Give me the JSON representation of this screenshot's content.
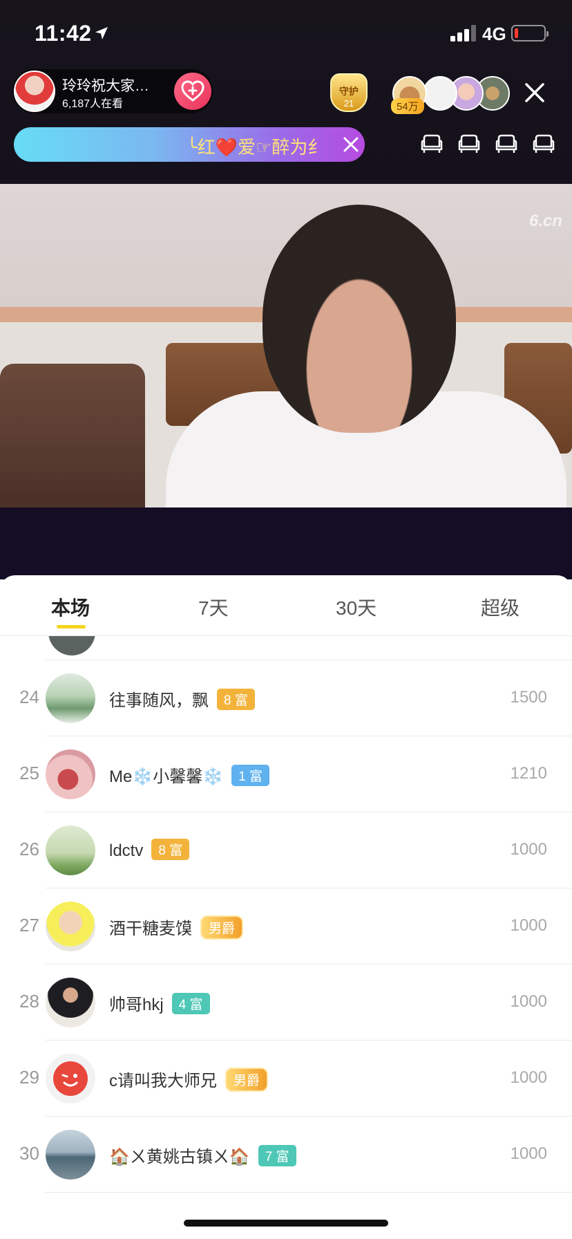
{
  "status_bar": {
    "time": "11:42",
    "network": "4G"
  },
  "live_header": {
    "host_name": "玲玲祝大家…",
    "viewers": "6,187人在看",
    "guard_label": "守护",
    "guard_count": "21",
    "fan_tag": "54万"
  },
  "marquee": {
    "text": "╰红❤️爱☞醉为纟"
  },
  "tabs": [
    {
      "label": "本场",
      "active": true
    },
    {
      "label": "7天",
      "active": false
    },
    {
      "label": "30天",
      "active": false
    },
    {
      "label": "超级",
      "active": false
    }
  ],
  "ranking": [
    {
      "rank": "24",
      "name": "往事随风，飘",
      "badge": "8 富",
      "badge_color": "#f3b33b",
      "score": "1500"
    },
    {
      "rank": "25",
      "name": "Me❄️小馨馨❄️",
      "badge": "1 富",
      "badge_color": "#5fb1ef",
      "score": "1210"
    },
    {
      "rank": "26",
      "name": "ldctv",
      "badge": "8 富",
      "badge_color": "#f3b33b",
      "score": "1000"
    },
    {
      "rank": "27",
      "name": "酒干糖麦馍",
      "badge": "男爵",
      "badge_color": "#f2a02b",
      "score": "1000"
    },
    {
      "rank": "28",
      "name": "帅哥hkj",
      "badge": "4 富",
      "badge_color": "#4ec7b6",
      "score": "1000"
    },
    {
      "rank": "29",
      "name": "c请叫我大师兄",
      "badge": "男爵",
      "badge_color": "#f2a02b",
      "score": "1000"
    },
    {
      "rank": "30",
      "name": "🏠ㄨ黄姚古镇ㄨ🏠",
      "badge": "7 富",
      "badge_color": "#4ec7b6",
      "score": "1000"
    }
  ],
  "video_watermark": "6.cn",
  "icons": {
    "location": "location-arrow-icon",
    "follow": "heart-plus-icon",
    "close": "close-icon",
    "seat": "sofa-seat-icon"
  }
}
